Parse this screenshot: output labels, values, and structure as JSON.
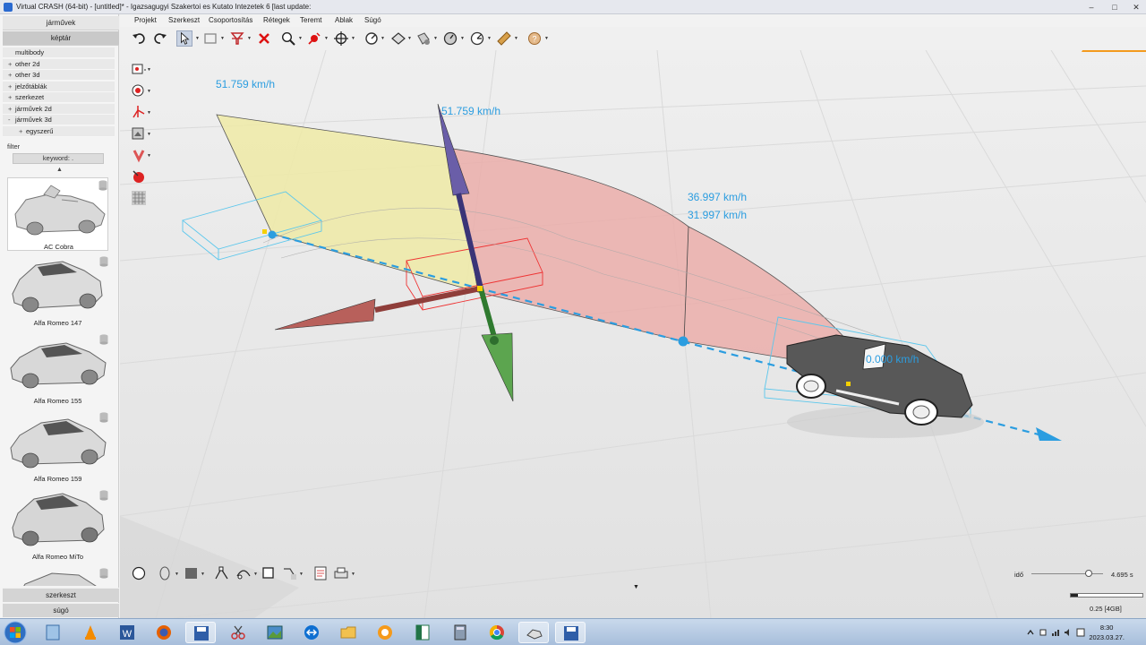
{
  "window": {
    "title": "Virtual CRASH (64-bit) - [untitled]* - Igazsagugyi Szakertoi es Kutato Intezetek 6 [last update:"
  },
  "menu": [
    "Projekt",
    "Szerkeszt",
    "Csoportosítás",
    "Rétegek",
    "Teremt",
    "Ablak",
    "Súgó"
  ],
  "left_panel": {
    "tabs": [
      "járművek",
      "képtár"
    ],
    "tree": [
      {
        "pm": "",
        "label": "multibody"
      },
      {
        "pm": "+",
        "label": "other 2d"
      },
      {
        "pm": "+",
        "label": "other 3d"
      },
      {
        "pm": "+",
        "label": "jelzőtáblák"
      },
      {
        "pm": "+",
        "label": "szerkezet"
      },
      {
        "pm": "+",
        "label": "járművek 2d"
      },
      {
        "pm": "-",
        "label": "járművek 3d"
      },
      {
        "pm": "+",
        "label": "egyszerű"
      }
    ],
    "filter_label": "filter",
    "keyword": "keyword: .",
    "vehicles": [
      "AC Cobra",
      "Alfa Romeo 147",
      "Alfa Romeo 155",
      "Alfa Romeo 159",
      "Alfa Romeo MiTo"
    ],
    "bottom_tabs": [
      "szerkeszt",
      "súgó"
    ]
  },
  "viewport": {
    "speeds": {
      "s1": "51.759 km/h",
      "s2": "51.759 km/h",
      "s3": "36.997 km/h",
      "s4": "31.997 km/h",
      "s5": "0.000 km/h"
    }
  },
  "timeline": {
    "label": "idő",
    "value": "4.695 s",
    "fraction": 0.8,
    "memory": "0.25 [4GB]",
    "memory_fraction": 0.1
  },
  "clock": {
    "time": "8:30",
    "date": "2023.03.27."
  },
  "colors": {
    "accent_blue": "#2b9de0",
    "logo_orange": "#f39a1e",
    "cone_yellow": "#efeaa6",
    "cone_red": "#ebaaa6"
  }
}
